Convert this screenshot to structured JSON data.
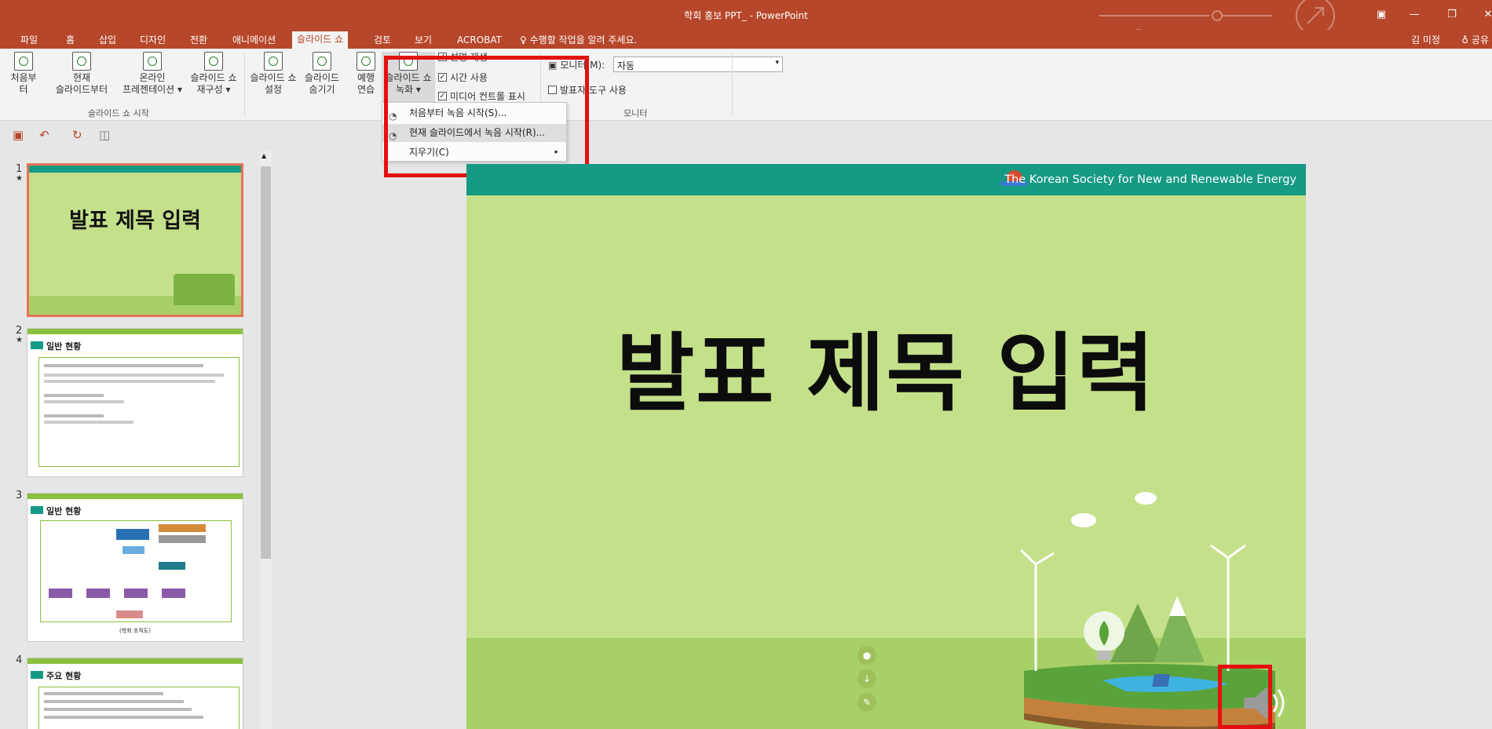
{
  "window": {
    "title": "학회 홍보 PPT_ - PowerPoint"
  },
  "menu_tabs": [
    "파일",
    "홈",
    "삽입",
    "디자인",
    "전환",
    "애니메이션",
    "슬라이드 쇼",
    "검토",
    "보기",
    "ACROBAT"
  ],
  "active_tab": "슬라이드 쇼",
  "tell_me": "수행할 작업을 알려 주세요.",
  "user_name": "김 미정",
  "share_label": "공유",
  "ribbon": {
    "btn_from_start": "처음부터",
    "btn_current_l1": "현재",
    "btn_current_l2": "슬라이드부터",
    "btn_online_l1": "온라인",
    "btn_online_l2": "프레젠테이션 ▾",
    "btn_custom_l1": "슬라이드 쇼",
    "btn_custom_l2": "재구성 ▾",
    "group_start": "슬라이드 쇼 시작",
    "btn_setup_l1": "슬라이드 쇼",
    "btn_setup_l2": "설정",
    "btn_hide_l1": "슬라이드",
    "btn_hide_l2": "숨기기",
    "btn_rehearse_l1": "예행",
    "btn_rehearse_l2": "연습",
    "btn_record_l1": "슬라이드 쇼",
    "btn_record_l2": "녹화 ▾",
    "chk_play_narration": "설명 재생",
    "chk_use_timings": "시간 사용",
    "chk_show_media": "미디어 컨트롤 표시",
    "monitor_label": "모니터(M):",
    "monitor_value": "자동",
    "chk_presenter_view": "발표자 도구 사용",
    "group_monitor": "모니터"
  },
  "dropdown": {
    "item1": "처음부터 녹음 시작(S)...",
    "item2": "현재 슬라이드에서 녹음 시작(R)...",
    "item3": "지우기(C)"
  },
  "thumbnails": [
    {
      "num": "1",
      "title": "발표 제목 입력"
    },
    {
      "num": "2",
      "title": "일반 현황"
    },
    {
      "num": "3",
      "title": "일반 현황",
      "caption": "(학회 조직도)"
    },
    {
      "num": "4",
      "title": "주요 현황"
    }
  ],
  "slide": {
    "org_name": "The Korean Society for New and Renewable Energy",
    "title": "발표 제목 입력"
  },
  "colors": {
    "accent": "#b7472a",
    "slide_band": "#159a84",
    "slide_bg": "#c5e08a",
    "highlight_box": "#e41010"
  }
}
